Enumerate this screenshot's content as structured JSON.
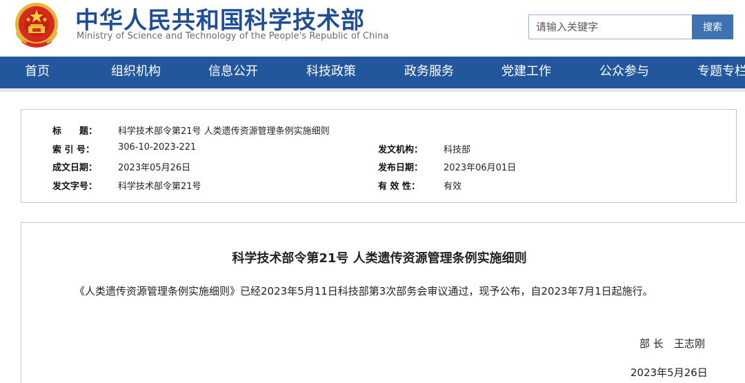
{
  "header": {
    "title": "中华人民共和国科学技术部",
    "subtitle": "Ministry of Science and Technology of the People's Republic of China",
    "emblem_icon": "national-emblem-icon",
    "brand_color": "#1f4e97"
  },
  "search": {
    "placeholder": "请输入关键字",
    "button_label": "搜索"
  },
  "nav": {
    "background_color": "#23579c",
    "items": [
      "首页",
      "组织机构",
      "信息公开",
      "科技政策",
      "政务服务",
      "党建工作",
      "公众参与",
      "专题专栏"
    ]
  },
  "info": {
    "title_label": "标　　题：",
    "title_value": "科学技术部令第21号 人类遗传资源管理条例实施细则",
    "index_label": "索 引 号：",
    "index_value": "306-10-2023-221",
    "issuer_label": "发文机构：",
    "issuer_value": "科技部",
    "created_label": "成文日期：",
    "created_value": "2023年05月26日",
    "published_label": "发布日期：",
    "published_value": "2023年06月01日",
    "docno_label": "发文字号：",
    "docno_value": "科学技术部令第21号",
    "validity_label": "有 效 性：",
    "validity_value": "有效"
  },
  "document": {
    "title": "科学技术部令第21号 人类遗传资源管理条例实施细则",
    "body": "《人类遗传资源管理条例实施细则》已经2023年5月11日科技部第3次部务会审议通过，现予公布，自2023年7月1日起施行。",
    "sign_role": "部 长",
    "sign_name": "王志刚",
    "sign_date": "2023年5月26日"
  }
}
